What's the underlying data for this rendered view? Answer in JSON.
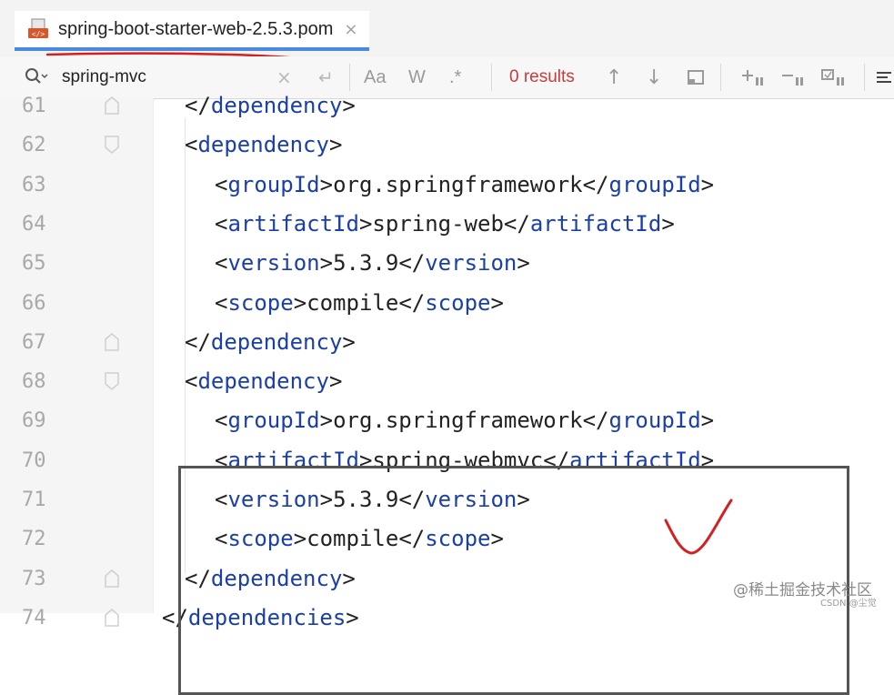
{
  "tab": {
    "title": "spring-boot-starter-web-2.5.3.pom",
    "icon": "xml-file-icon",
    "close_label": "×"
  },
  "search": {
    "value": "spring-mvc",
    "clear_label": "×",
    "enter_label": "↵",
    "match_case_label": "Aa",
    "words_label": "W",
    "regex_label": ".*",
    "results_text": "0 results",
    "prev_label": "↑",
    "next_label": "↓"
  },
  "colors": {
    "tag": "#1a3fa8",
    "accent_tab": "#4a8be0",
    "annotation_red": "#d42020",
    "results_red": "#c93b3b"
  },
  "code_lines": [
    {
      "num": "61",
      "indent": 1,
      "kind": "close",
      "tag": "dependency"
    },
    {
      "num": "62",
      "indent": 1,
      "kind": "open",
      "tag": "dependency"
    },
    {
      "num": "63",
      "indent": 2,
      "kind": "element",
      "tag": "groupId",
      "text": "org.springframework"
    },
    {
      "num": "64",
      "indent": 2,
      "kind": "element",
      "tag": "artifactId",
      "text": "spring-web"
    },
    {
      "num": "65",
      "indent": 2,
      "kind": "element",
      "tag": "version",
      "text": "5.3.9"
    },
    {
      "num": "66",
      "indent": 2,
      "kind": "element",
      "tag": "scope",
      "text": "compile"
    },
    {
      "num": "67",
      "indent": 1,
      "kind": "close",
      "tag": "dependency"
    },
    {
      "num": "68",
      "indent": 1,
      "kind": "open",
      "tag": "dependency"
    },
    {
      "num": "69",
      "indent": 2,
      "kind": "element",
      "tag": "groupId",
      "text": "org.springframework"
    },
    {
      "num": "70",
      "indent": 2,
      "kind": "element",
      "tag": "artifactId",
      "text": "spring-webmvc"
    },
    {
      "num": "71",
      "indent": 2,
      "kind": "element",
      "tag": "version",
      "text": "5.3.9"
    },
    {
      "num": "72",
      "indent": 2,
      "kind": "element",
      "tag": "scope",
      "text": "compile"
    },
    {
      "num": "73",
      "indent": 1,
      "kind": "close",
      "tag": "dependency"
    },
    {
      "num": "74",
      "indent": 0,
      "kind": "close",
      "tag": "dependencies"
    }
  ],
  "watermark": {
    "line1": "@稀土掘金技术社区",
    "line2": "CSDN @尘觉"
  }
}
